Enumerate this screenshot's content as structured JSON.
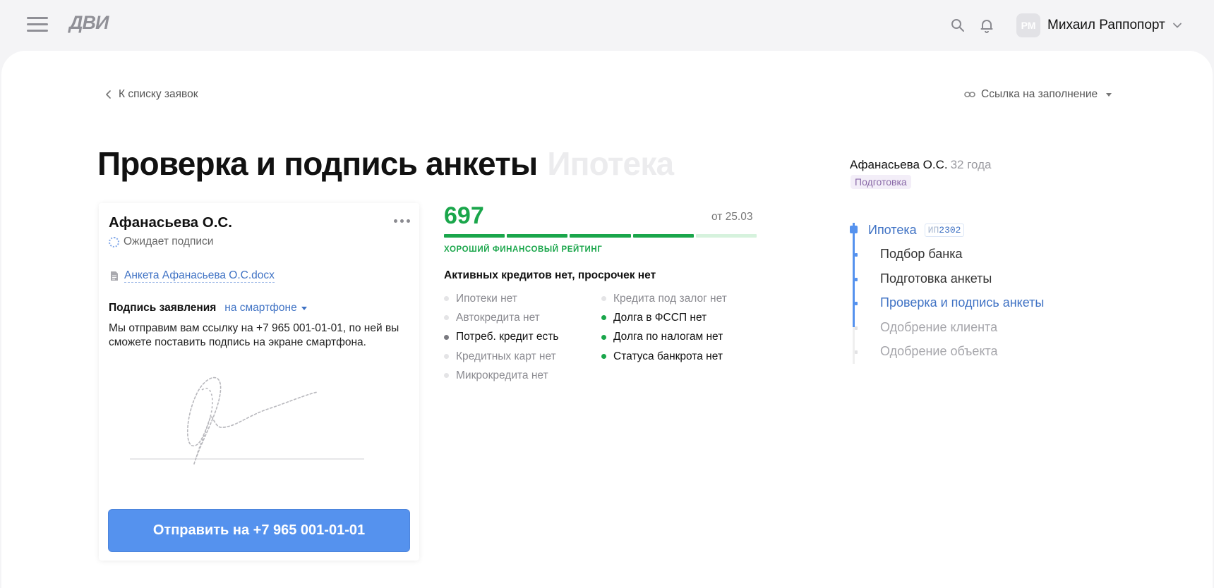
{
  "header": {
    "logo": "ДВИ",
    "user_initials": "РМ",
    "user_name": "Михаил Раппопорт"
  },
  "nav": {
    "back_label": "К списку заявок",
    "fill_link_label": "Ссылка на заполнение"
  },
  "page": {
    "title": "Проверка и подпись анкеты",
    "subtitle": "Ипотека"
  },
  "card": {
    "name": "Афанасьева О.С.",
    "status": "Ожидает подписи",
    "document": "Анкета Афанасьева О.С.docx",
    "sign_label": "Подпись заявления",
    "sign_method": "на смартфоне",
    "sign_description": "Мы отправим вам ссылку на +7 965 001-01-01, по ней вы сможете поставить подпись на экране смартфона.",
    "send_button": "Отправить на +7 965 001-01-01"
  },
  "credit": {
    "score": "697",
    "date": "от 25.03",
    "score_segments_filled": 4,
    "score_segments_total": 5,
    "rating_label": "ХОРОШИЙ ФИНАНСОВЫЙ РЕЙТИНГ",
    "headline": "Активных кредитов нет, просрочек нет",
    "col1": [
      {
        "text": "Ипотеки нет",
        "state": "none"
      },
      {
        "text": "Автокредита нет",
        "state": "none"
      },
      {
        "text": "Потреб. кредит есть",
        "state": "present"
      },
      {
        "text": "Кредитных карт нет",
        "state": "none"
      },
      {
        "text": "Микрокредита нет",
        "state": "none"
      }
    ],
    "col2": [
      {
        "text": "Кредита под залог нет",
        "state": "none"
      },
      {
        "text": "Долга в ФССП нет",
        "state": "good"
      },
      {
        "text": "Долга по налогам нет",
        "state": "good"
      },
      {
        "text": "Статуса банкрота нет",
        "state": "good"
      }
    ],
    "colors": {
      "none": "#e4e4e6",
      "present": "#7a7a80",
      "good": "#1aa64b",
      "score": "#1aa64b",
      "score_empty": "#d6f2dd"
    }
  },
  "client": {
    "name": "Афанасьева О.С.",
    "age": "32 года",
    "stage": "Подготовка"
  },
  "timeline": {
    "product": "Ипотека",
    "product_tag_prefix": "ИП",
    "product_tag_number": "2302",
    "steps": [
      {
        "label": "Подбор банка",
        "state": "done"
      },
      {
        "label": "Подготовка анкеты",
        "state": "done"
      },
      {
        "label": "Проверка и подпись анкеты",
        "state": "current"
      },
      {
        "label": "Одобрение клиента",
        "state": "future"
      },
      {
        "label": "Одобрение объекта",
        "state": "future"
      }
    ]
  }
}
